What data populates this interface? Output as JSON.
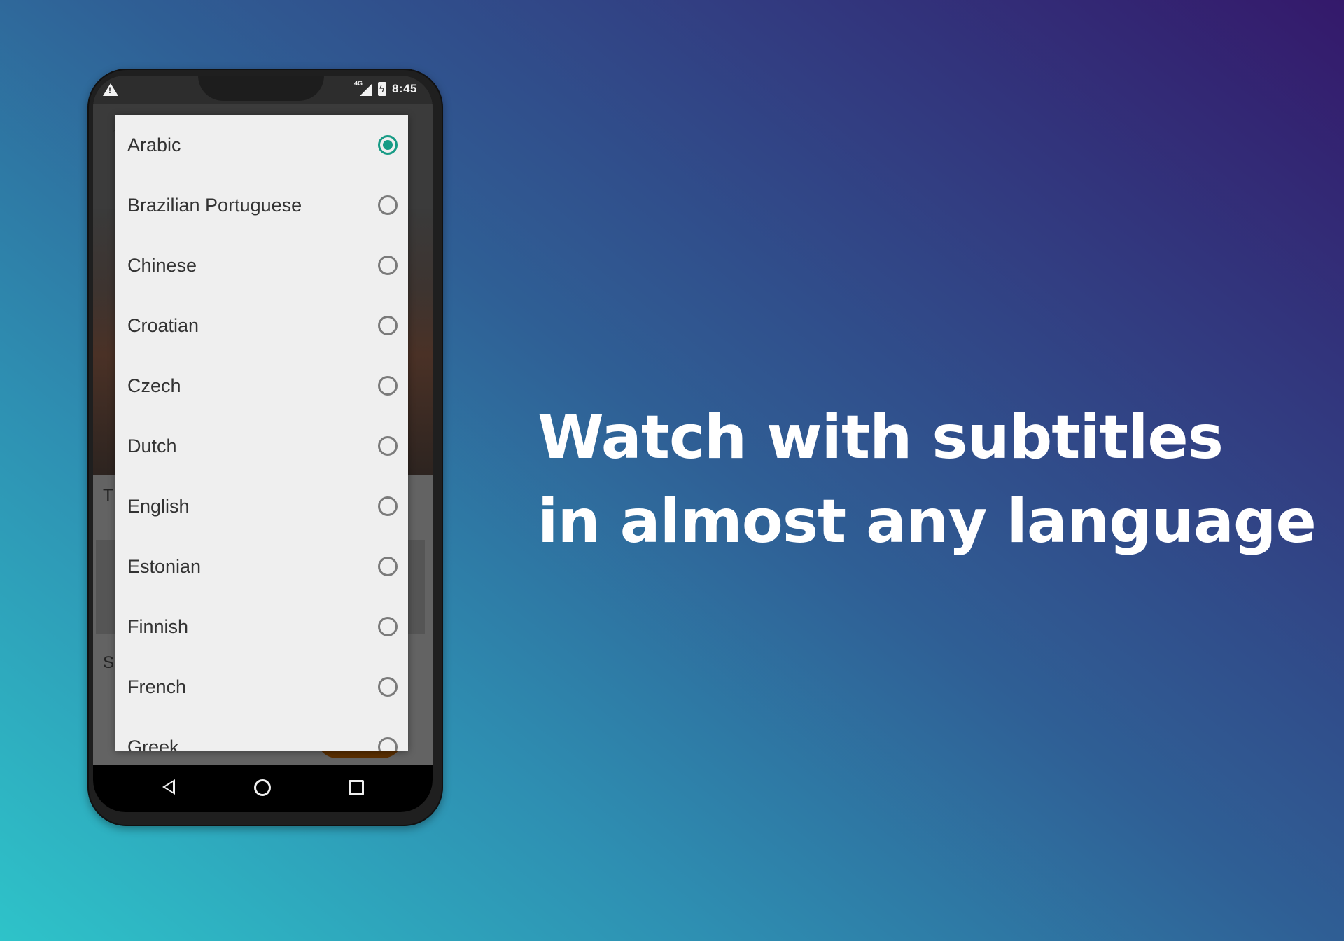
{
  "status_bar": {
    "alert_icon": "warning-triangle-icon",
    "network_label": "4G",
    "signal_icon": "cellular-signal-icon",
    "battery_icon": "battery-charging-icon",
    "time": "8:45"
  },
  "background_screen": {
    "partial_letters": [
      "T",
      "S"
    ]
  },
  "language_dialog": {
    "selected": "Arabic",
    "accent_color": "#169b85",
    "options": [
      {
        "label": "Arabic",
        "checked": true
      },
      {
        "label": "Brazilian Portuguese",
        "checked": false
      },
      {
        "label": "Chinese",
        "checked": false
      },
      {
        "label": "Croatian",
        "checked": false
      },
      {
        "label": "Czech",
        "checked": false
      },
      {
        "label": "Dutch",
        "checked": false
      },
      {
        "label": "English",
        "checked": false
      },
      {
        "label": "Estonian",
        "checked": false
      },
      {
        "label": "Finnish",
        "checked": false
      },
      {
        "label": "French",
        "checked": false
      },
      {
        "label": "Greek",
        "checked": false
      }
    ]
  },
  "nav_bar": {
    "back_icon": "back-triangle-icon",
    "home_icon": "home-circle-icon",
    "recents_icon": "recents-square-icon"
  },
  "headline": {
    "line1": "Watch with subtitles",
    "line2": "in almost any language"
  }
}
